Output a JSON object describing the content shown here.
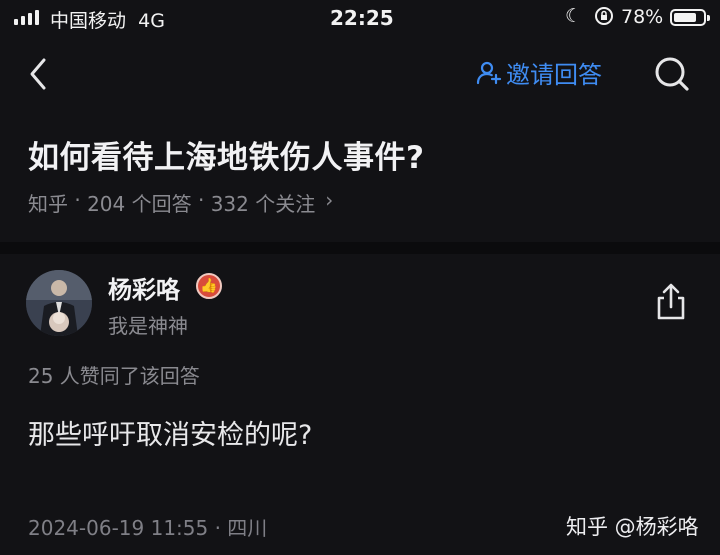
{
  "status_bar": {
    "carrier": "中国移动",
    "network": "4G",
    "time": "22:25",
    "battery": "78%",
    "battery_level": 0.78,
    "icons": [
      "signal-icon",
      "moon-icon",
      "orientation-lock-icon",
      "battery-icon"
    ]
  },
  "nav": {
    "back_icon": "chevron-left-icon",
    "invite_label": "邀请回答",
    "invite_icon": "person-add-icon",
    "search_icon": "search-icon",
    "accent_color": "#3f8cf2"
  },
  "question": {
    "title": "如何看待上海地铁伤人事件?",
    "meta": {
      "source": "知乎",
      "answers": "204 个回答",
      "followers": "332 个关注",
      "chevron": "›",
      "sep": " · "
    }
  },
  "answer": {
    "author_name": "杨彩咯",
    "author_bio": "我是神神",
    "badge_icon": "thumbs-up-badge-icon",
    "share_icon": "share-icon",
    "likes_text": "25 人赞同了该回答",
    "content": "那些呼吁取消安检的呢?",
    "date_location": "2024-06-19 11:55 · 四川"
  },
  "watermark": "知乎 @杨彩咯"
}
